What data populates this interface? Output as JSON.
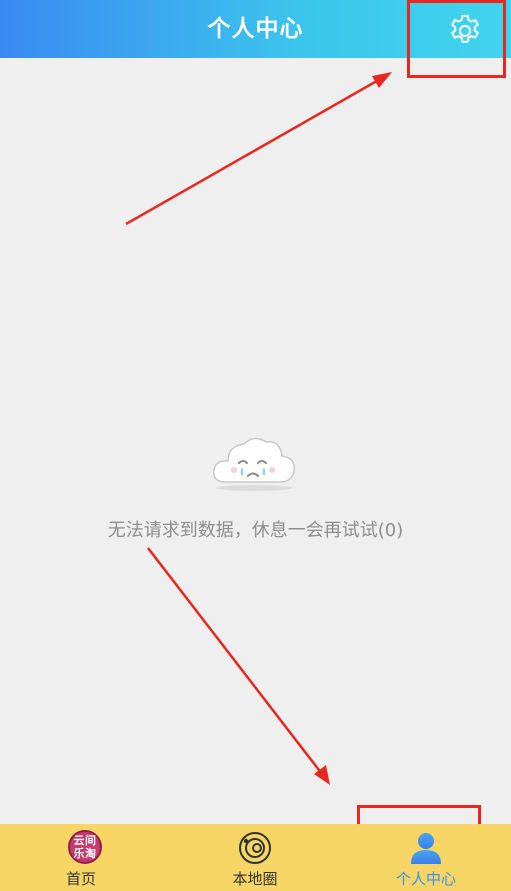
{
  "header": {
    "title": "个人中心",
    "settings_icon": "gear-icon"
  },
  "empty_state": {
    "icon": "crying-cloud-icon",
    "message": "无法请求到数据，休息一会再试试(0)"
  },
  "tabbar": {
    "tabs": [
      {
        "label": "首页",
        "icon": "yunjian-letao-logo",
        "logo_line1": "云间",
        "logo_line2": "乐淘",
        "active": false
      },
      {
        "label": "本地圈",
        "icon": "local-circle-icon",
        "active": false
      },
      {
        "label": "个人中心",
        "icon": "user-profile-icon",
        "active": true
      }
    ]
  },
  "colors": {
    "header_start": "#3a8af2",
    "header_end": "#3ed5ee",
    "tabbar_bg": "#f7d666",
    "active_tab": "#3f8ef0",
    "annotation": "#e8281f"
  }
}
